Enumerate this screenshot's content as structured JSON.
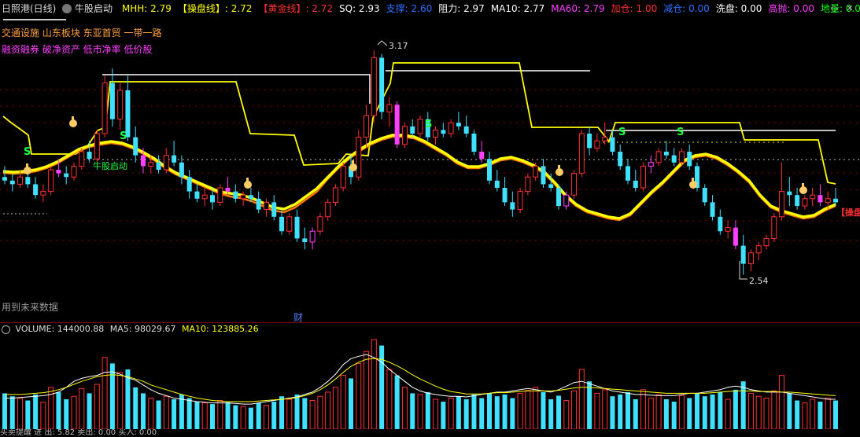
{
  "header": {
    "stock_name": "日照港(日线)",
    "indicator_name": "牛股启动",
    "items": [
      {
        "label": "MHH: 2.79",
        "color": "#ffff00"
      },
      {
        "label": "【操盘线】: 2.72",
        "color": "#ffff00"
      },
      {
        "label": "【黄金线】: 2.72",
        "color": "#ff3030"
      },
      {
        "label": "SQ: 2.93",
        "color": "#ffffff"
      },
      {
        "label": "支撑: 2.60",
        "color": "#3070ff"
      },
      {
        "label": "阻力: 2.97",
        "color": "#ffffff"
      },
      {
        "label": "MA10: 2.77",
        "color": "#ffffff"
      },
      {
        "label": "MA60: 2.79",
        "color": "#ff40ff"
      },
      {
        "label": "加仓: 1.00",
        "color": "#ff3030"
      },
      {
        "label": "减仓: 0.00",
        "color": "#3070ff"
      },
      {
        "label": "洗盘: 0.00",
        "color": "#ffffff"
      },
      {
        "label": "高抛: 0.00",
        "color": "#ff40ff"
      },
      {
        "label": "地量: 0.00",
        "color": "#00ff00"
      }
    ]
  },
  "info": {
    "blocks_line1": "交通设施 山东板块 东亚首贸 一带一路",
    "blocks_line2": "融资融券 破净资产 低市净率 低价股",
    "future_data_note": "用到未来数据",
    "finance_marker": "财",
    "start_label": "牛股启动",
    "right_label": "【操盘",
    "signal_s": "S"
  },
  "price_labels": {
    "high": "3.17",
    "low": "2.54"
  },
  "volume_header": {
    "volume": "VOLUME: 144000.88",
    "ma5": "MA5: 98029.67",
    "ma10": "MA10: 123885.26"
  },
  "bottom_bar": {
    "text": "买卖提醒  进  出: 5.82  卖出: 0.00  买入: 0.00"
  },
  "window_controls": [
    {
      "icon": "diamond-icon",
      "glyph": "◇"
    },
    {
      "icon": "close-icon",
      "glyph": "✕"
    }
  ],
  "colors": {
    "up": "#ff3030",
    "down": "#40e0ff",
    "magenta": "#ff40ff",
    "yellow": "#ffff00",
    "orange": "#ff7800",
    "white": "#ffffff",
    "grid": "#7a0000"
  },
  "chart_data": {
    "type": "candlestick",
    "price_range": [
      2.44,
      3.24
    ],
    "volume_range": [
      0,
      150000
    ],
    "candles": [
      [
        2.82,
        2.85,
        2.8,
        2.81,
        60
      ],
      [
        2.81,
        2.83,
        2.78,
        2.8,
        55
      ],
      [
        2.8,
        2.84,
        2.79,
        2.82,
        52
      ],
      [
        2.82,
        2.83,
        2.79,
        2.8,
        48
      ],
      [
        2.8,
        2.82,
        2.76,
        2.77,
        58
      ],
      [
        2.77,
        2.8,
        2.75,
        2.78,
        45
      ],
      [
        2.78,
        2.85,
        2.77,
        2.84,
        70
      ],
      [
        2.84,
        2.87,
        2.82,
        2.83,
        62
      ],
      [
        2.83,
        2.85,
        2.8,
        2.82,
        50
      ],
      [
        2.82,
        2.86,
        2.81,
        2.85,
        55
      ],
      [
        2.85,
        2.9,
        2.84,
        2.89,
        68
      ],
      [
        2.89,
        2.92,
        2.86,
        2.87,
        60
      ],
      [
        2.87,
        2.95,
        2.86,
        2.94,
        75
      ],
      [
        2.94,
        3.1,
        2.93,
        3.08,
        120
      ],
      [
        3.08,
        3.12,
        2.96,
        2.98,
        110
      ],
      [
        2.98,
        3.08,
        2.95,
        3.06,
        95
      ],
      [
        3.06,
        3.1,
        2.92,
        2.93,
        100
      ],
      [
        2.93,
        2.96,
        2.86,
        2.88,
        70
      ],
      [
        2.88,
        2.9,
        2.83,
        2.85,
        60
      ],
      [
        2.85,
        2.88,
        2.83,
        2.86,
        52
      ],
      [
        2.86,
        2.88,
        2.83,
        2.84,
        48
      ],
      [
        2.84,
        2.9,
        2.83,
        2.88,
        55
      ],
      [
        2.88,
        2.92,
        2.85,
        2.86,
        50
      ],
      [
        2.86,
        2.88,
        2.8,
        2.82,
        58
      ],
      [
        2.82,
        2.84,
        2.76,
        2.78,
        52
      ],
      [
        2.78,
        2.8,
        2.75,
        2.76,
        46
      ],
      [
        2.76,
        2.79,
        2.74,
        2.77,
        44
      ],
      [
        2.77,
        2.79,
        2.73,
        2.75,
        42
      ],
      [
        2.75,
        2.8,
        2.74,
        2.79,
        48
      ],
      [
        2.79,
        2.82,
        2.77,
        2.78,
        45
      ],
      [
        2.78,
        2.8,
        2.75,
        2.76,
        40
      ],
      [
        2.76,
        2.78,
        2.74,
        2.77,
        38
      ],
      [
        2.77,
        2.79,
        2.75,
        2.76,
        36
      ],
      [
        2.76,
        2.78,
        2.72,
        2.73,
        44
      ],
      [
        2.73,
        2.76,
        2.71,
        2.75,
        40
      ],
      [
        2.75,
        2.77,
        2.7,
        2.71,
        46
      ],
      [
        2.71,
        2.73,
        2.66,
        2.67,
        55
      ],
      [
        2.67,
        2.72,
        2.66,
        2.71,
        50
      ],
      [
        2.71,
        2.73,
        2.64,
        2.65,
        58
      ],
      [
        2.65,
        2.68,
        2.62,
        2.64,
        52
      ],
      [
        2.64,
        2.68,
        2.62,
        2.67,
        48
      ],
      [
        2.67,
        2.72,
        2.66,
        2.71,
        55
      ],
      [
        2.71,
        2.76,
        2.7,
        2.75,
        62
      ],
      [
        2.75,
        2.8,
        2.74,
        2.79,
        70
      ],
      [
        2.79,
        2.86,
        2.78,
        2.85,
        90
      ],
      [
        2.85,
        2.88,
        2.8,
        2.82,
        85
      ],
      [
        2.82,
        2.95,
        2.81,
        2.93,
        110
      ],
      [
        2.93,
        3.02,
        2.9,
        2.99,
        130
      ],
      [
        2.99,
        3.17,
        2.97,
        3.15,
        150
      ],
      [
        3.15,
        3.16,
        2.98,
        3.0,
        140
      ],
      [
        3.0,
        3.04,
        2.96,
        3.02,
        100
      ],
      [
        3.02,
        3.03,
        2.9,
        2.91,
        90
      ],
      [
        2.91,
        2.97,
        2.9,
        2.96,
        70
      ],
      [
        2.96,
        2.98,
        2.93,
        2.94,
        60
      ],
      [
        2.94,
        2.99,
        2.93,
        2.98,
        58
      ],
      [
        2.98,
        3.0,
        2.92,
        2.93,
        62
      ],
      [
        2.93,
        2.96,
        2.91,
        2.95,
        50
      ],
      [
        2.95,
        2.97,
        2.93,
        2.94,
        46
      ],
      [
        2.94,
        2.98,
        2.93,
        2.97,
        52
      ],
      [
        2.97,
        3.0,
        2.95,
        2.96,
        55
      ],
      [
        2.96,
        2.99,
        2.93,
        2.94,
        50
      ],
      [
        2.94,
        2.95,
        2.88,
        2.89,
        58
      ],
      [
        2.89,
        2.92,
        2.86,
        2.87,
        52
      ],
      [
        2.87,
        2.89,
        2.8,
        2.81,
        60
      ],
      [
        2.81,
        2.84,
        2.78,
        2.79,
        55
      ],
      [
        2.79,
        2.82,
        2.74,
        2.75,
        58
      ],
      [
        2.75,
        2.78,
        2.71,
        2.73,
        52
      ],
      [
        2.73,
        2.79,
        2.72,
        2.78,
        60
      ],
      [
        2.78,
        2.83,
        2.77,
        2.82,
        65
      ],
      [
        2.82,
        2.86,
        2.81,
        2.85,
        70
      ],
      [
        2.85,
        2.87,
        2.79,
        2.8,
        62
      ],
      [
        2.8,
        2.83,
        2.78,
        2.79,
        50
      ],
      [
        2.79,
        2.8,
        2.73,
        2.74,
        56
      ],
      [
        2.74,
        2.78,
        2.73,
        2.77,
        48
      ],
      [
        2.77,
        2.84,
        2.76,
        2.83,
        64
      ],
      [
        2.83,
        2.95,
        2.82,
        2.94,
        100
      ],
      [
        2.94,
        2.96,
        2.88,
        2.9,
        80
      ],
      [
        2.9,
        2.94,
        2.89,
        2.92,
        60
      ],
      [
        2.92,
        2.97,
        2.91,
        2.93,
        66
      ],
      [
        2.93,
        2.95,
        2.88,
        2.89,
        55
      ],
      [
        2.89,
        2.91,
        2.84,
        2.85,
        58
      ],
      [
        2.85,
        2.87,
        2.8,
        2.81,
        62
      ],
      [
        2.81,
        2.84,
        2.78,
        2.79,
        50
      ],
      [
        2.79,
        2.86,
        2.78,
        2.85,
        66
      ],
      [
        2.85,
        2.88,
        2.83,
        2.86,
        52
      ],
      [
        2.86,
        2.9,
        2.85,
        2.89,
        58
      ],
      [
        2.89,
        2.92,
        2.87,
        2.88,
        50
      ],
      [
        2.88,
        2.9,
        2.85,
        2.86,
        46
      ],
      [
        2.86,
        2.9,
        2.85,
        2.89,
        56
      ],
      [
        2.89,
        2.91,
        2.84,
        2.85,
        52
      ],
      [
        2.85,
        2.86,
        2.78,
        2.79,
        60
      ],
      [
        2.79,
        2.8,
        2.74,
        2.75,
        55
      ],
      [
        2.75,
        2.77,
        2.7,
        2.71,
        58
      ],
      [
        2.71,
        2.73,
        2.66,
        2.67,
        62
      ],
      [
        2.67,
        2.7,
        2.65,
        2.68,
        50
      ],
      [
        2.68,
        2.7,
        2.62,
        2.63,
        66
      ],
      [
        2.63,
        2.66,
        2.55,
        2.58,
        80
      ],
      [
        2.58,
        2.62,
        2.56,
        2.61,
        60
      ],
      [
        2.61,
        2.64,
        2.59,
        2.63,
        55
      ],
      [
        2.63,
        2.66,
        2.62,
        2.65,
        52
      ],
      [
        2.65,
        2.72,
        2.64,
        2.71,
        64
      ],
      [
        2.71,
        2.86,
        2.7,
        2.78,
        90
      ],
      [
        2.78,
        2.82,
        2.74,
        2.77,
        60
      ],
      [
        2.77,
        2.79,
        2.73,
        2.74,
        48
      ],
      [
        2.74,
        2.77,
        2.73,
        2.76,
        44
      ],
      [
        2.76,
        2.79,
        2.74,
        2.77,
        50
      ],
      [
        2.77,
        2.8,
        2.74,
        2.75,
        46
      ],
      [
        2.75,
        2.78,
        2.73,
        2.76,
        52
      ],
      [
        2.76,
        2.79,
        2.74,
        2.75,
        48
      ]
    ],
    "volume_ma5": [
      52,
      52,
      53,
      54,
      55,
      56,
      58,
      62,
      70,
      80,
      85,
      88,
      90,
      95,
      96,
      92,
      86,
      82,
      74,
      66,
      60,
      56,
      52,
      50,
      48,
      46,
      45,
      44,
      44,
      44,
      43,
      42,
      42,
      44,
      46,
      48,
      50,
      52,
      54,
      58,
      62,
      70,
      80,
      92,
      108,
      118,
      122,
      125,
      120,
      112,
      100,
      90,
      80,
      70,
      64,
      60,
      58,
      56,
      55,
      55,
      54,
      56,
      58,
      60,
      62,
      62,
      64,
      66,
      68,
      66,
      64,
      62,
      66,
      72,
      78,
      80,
      76,
      72,
      68,
      64,
      62,
      60,
      58,
      58,
      57,
      56,
      56,
      56,
      58,
      60,
      60,
      62,
      64,
      66,
      70,
      72,
      70,
      66,
      64,
      62,
      62,
      62,
      60,
      58,
      56,
      54,
      52,
      50,
      50
    ],
    "volume_ma10": [
      58,
      58,
      58,
      59,
      60,
      61,
      63,
      66,
      70,
      75,
      80,
      84,
      88,
      90,
      91,
      90,
      88,
      84,
      80,
      74,
      70,
      66,
      62,
      58,
      55,
      52,
      50,
      48,
      47,
      46,
      46,
      46,
      46,
      47,
      48,
      49,
      50,
      51,
      53,
      56,
      60,
      66,
      74,
      84,
      95,
      105,
      112,
      117,
      118,
      117,
      112,
      106,
      99,
      91,
      84,
      78,
      72,
      67,
      63,
      61,
      59,
      59,
      59,
      60,
      61,
      61,
      62,
      63,
      64,
      64,
      64,
      64,
      65,
      67,
      69,
      70,
      70,
      69,
      68,
      67,
      66,
      65,
      64,
      63,
      62,
      61,
      60,
      60,
      60,
      60,
      60,
      60,
      61,
      62,
      63,
      64,
      64,
      64,
      63,
      63,
      63,
      62,
      62,
      61,
      60,
      59,
      58,
      57,
      56
    ]
  }
}
